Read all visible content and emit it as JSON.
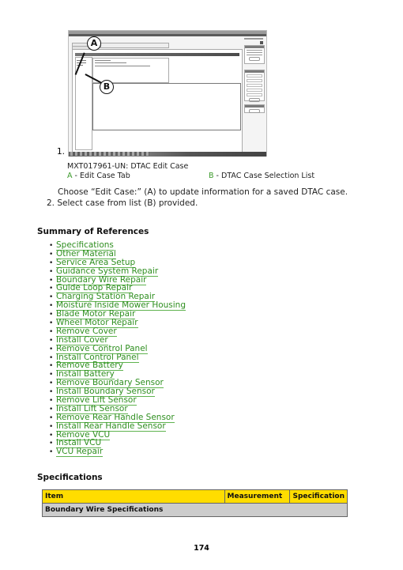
{
  "figure": {
    "callout_a": "A",
    "callout_b": "B",
    "step_number": "1."
  },
  "caption": {
    "id_title": "MXT017961-UN: DTAC Edit Case",
    "legend_a_key": "A",
    "legend_a_text": " - Edit Case Tab",
    "legend_b_key": "B",
    "legend_b_text": " - DTAC Case Selection List"
  },
  "steps": {
    "step1_text": "Choose “Edit Case:” (A) to update information for a saved DTAC case.",
    "step2_number": "2.",
    "step2_text": "Select case from list (B) provided."
  },
  "summary": {
    "heading": "Summary of References",
    "links": [
      "Specifications",
      "Other Material",
      "Service Area Setup",
      "Guidance System Repair",
      "Boundary Wire Repair",
      "Guide Loop Repair",
      "Charging Station Repair",
      "Moisture Inside Mower Housing",
      "Blade Motor Repair",
      "Wheel Motor Repair",
      "Remove Cover",
      "Install Cover",
      "Remove Control Panel",
      "Install Control Panel",
      "Remove Battery",
      "Install Battery",
      "Remove Boundary Sensor",
      "Install Boundary Sensor",
      "Remove Lift Sensor",
      "Install Lift Sensor",
      "Remove Rear Handle Sensor",
      "Install Rear Handle Sensor",
      "Remove VCU",
      "Install VCU",
      "VCU Repair"
    ]
  },
  "specifications": {
    "heading": "Specifications",
    "columns": [
      "Item",
      "Measurement",
      "Specification"
    ],
    "group_row": "Boundary Wire Specifications"
  },
  "page_number": "174",
  "colors": {
    "link": "#2f8f20",
    "legend_key": "#3a9a2a",
    "table_header": "#ffdd00",
    "table_group": "#cccccc"
  }
}
